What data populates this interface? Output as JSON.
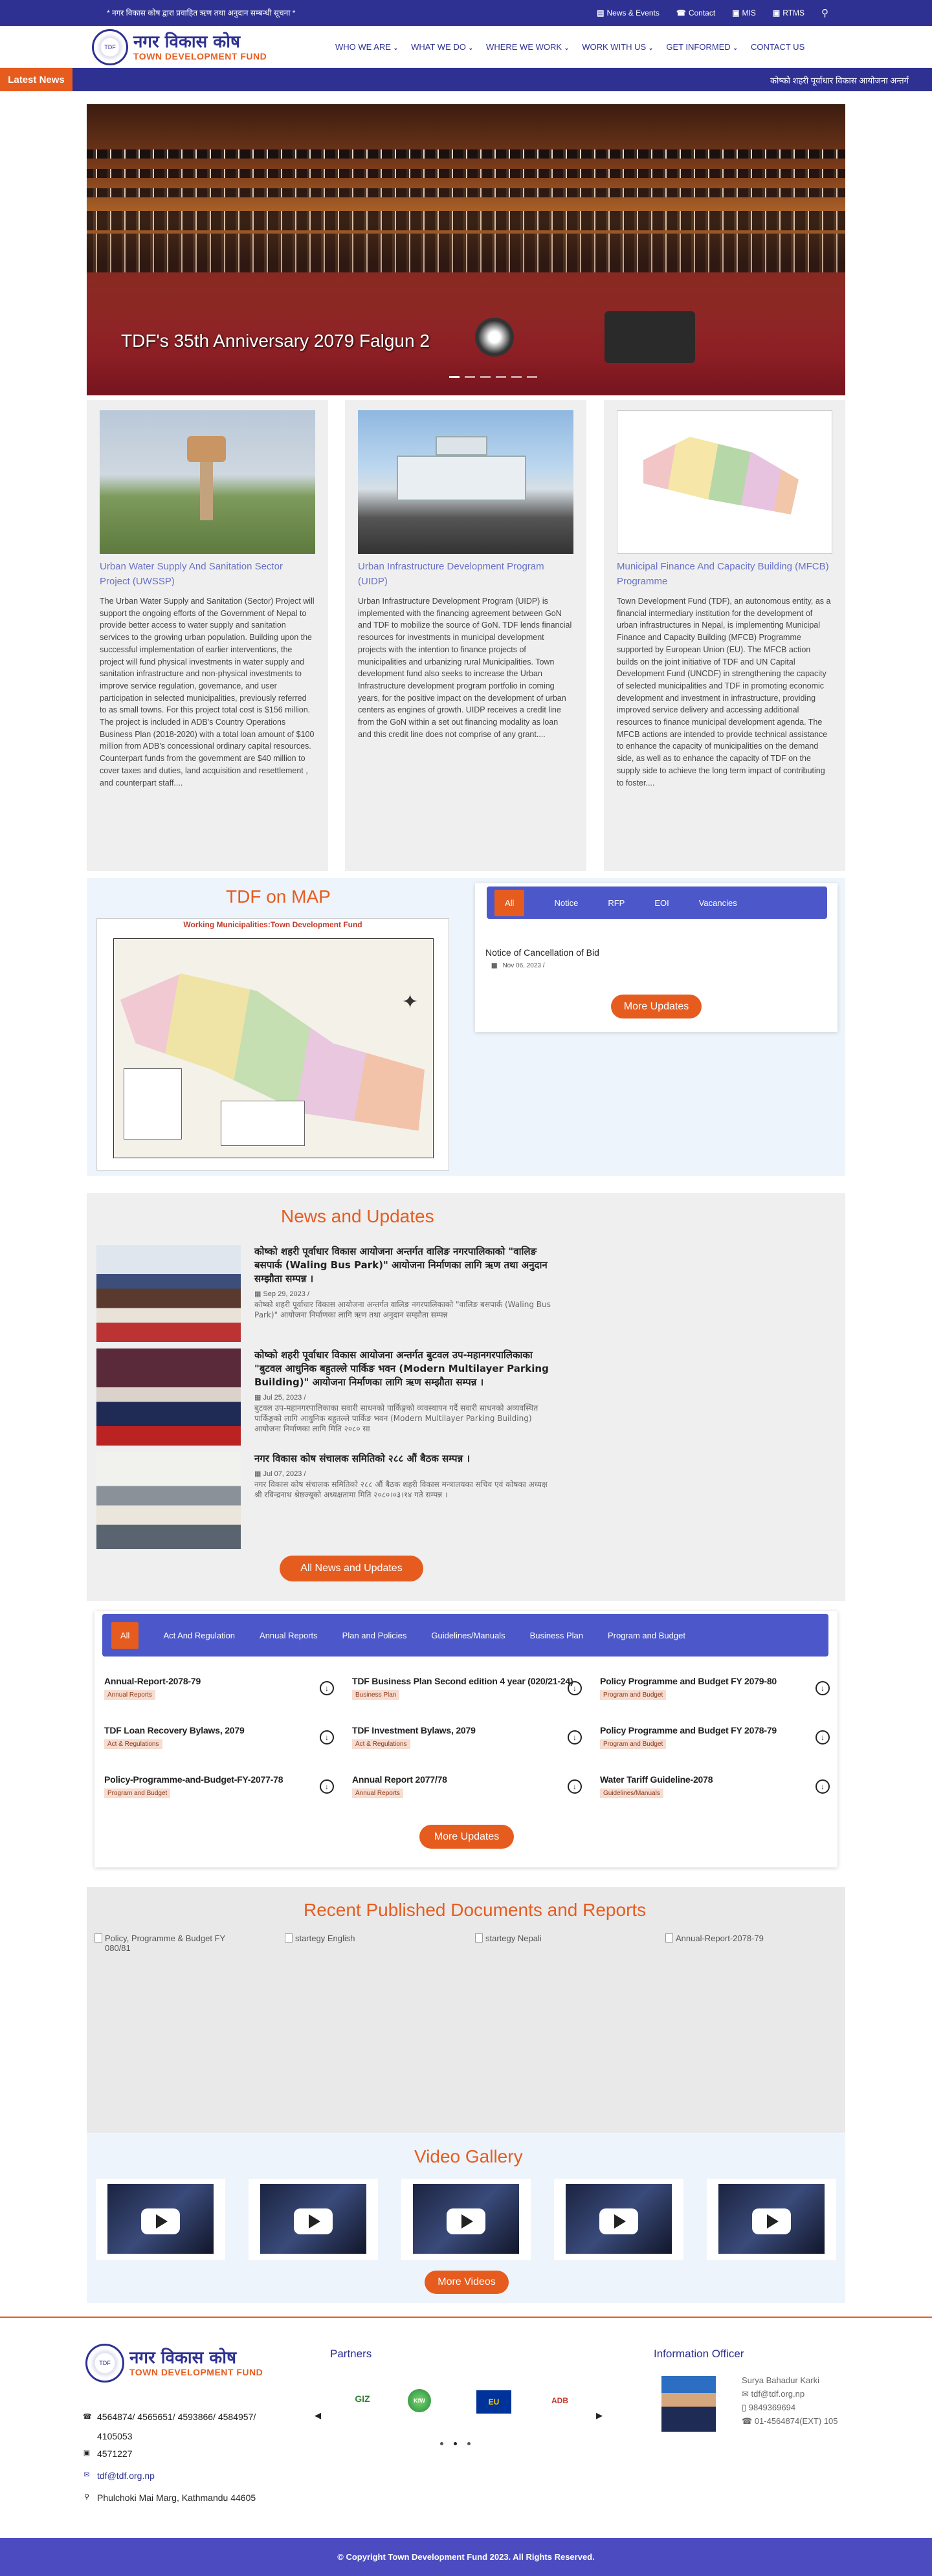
{
  "topbar": {
    "marquee": "* नगर विकास कोष द्वारा प्रवाहित ऋण तथा अनुदान सम्बन्धी सूचना *",
    "links": [
      {
        "icon": "news-icon",
        "label": "News & Events"
      },
      {
        "icon": "phone-icon",
        "label": "Contact"
      },
      {
        "icon": "mis-icon",
        "label": "MIS"
      },
      {
        "icon": "rtms-icon",
        "label": "RTMS"
      }
    ]
  },
  "brand": {
    "name_np": "नगर विकास कोष",
    "name_en": "TOWN DEVELOPMENT FUND"
  },
  "nav": {
    "items": [
      "WHO WE ARE",
      "WHAT WE DO",
      "WHERE WE WORK",
      "WORK WITH US",
      "GET INFORMED",
      "CONTACT US"
    ]
  },
  "latest": {
    "label": "Latest News",
    "text": "कोष्को शहरी पूर्वाधार विकास आयोजना अन्तर्ग"
  },
  "slider": {
    "caption": "TDF's 35th Anniversary 2079 Falgun 2"
  },
  "projects": [
    {
      "title": "Urban Water Supply And Sanitation Sector Project (UWSSP)",
      "text": "The Urban Water Supply and Sanitation (Sector) Project will support the ongoing efforts of the Government of Nepal to provide better access to water supply and sanitation services to the growing urban population. Building upon the successful implementation of earlier interventions, the project will fund physical investments in water supply and sanitation infrastructure and non-physical investments to improve service regulation, governance, and user participation in selected municipalities, previously referred to as small towns. For this project total cost is $156 million. The project is included in ADB's Country Operations Business Plan (2018-2020) with a total loan amount of $100 million from ADB's concessional ordinary capital resources. Counterpart funds from the government are $40 million to cover taxes and duties, land acquisition and resettlement , and counterpart staff...."
    },
    {
      "title": "Urban Infrastructure Development Program (UIDP)",
      "text": "Urban Infrastructure Development Program (UIDP) is implemented with the financing agreement between GoN and TDF to mobilize the source of GoN. TDF lends financial resources for investments in municipal development projects with the intention to finance projects of municipalities and urbanizing rural Municipalities. Town development fund also seeks to increase the Urban Infrastructure development program portfolio in coming years, for the positive impact on the development of urban centers as engines of growth. UIDP receives a credit line from the GoN within a set out financing modality as loan and this credit line does not comprise of any grant...."
    },
    {
      "title": "Municipal Finance And Capacity Building (MFCB) Programme",
      "text": "Town Development Fund (TDF), an autonomous entity, as a financial intermediary institution for the development of urban infrastructures in Nepal, is implementing Municipal Finance and Capacity Building (MFCB) Programme supported by European Union (EU). The MFCB action builds on the joint initiative of TDF and UN Capital Development Fund (UNCDF) in strengthening the capacity of selected municipalities and TDF in promoting economic development and investment in infrastructure, providing improved service delivery and accessing additional resources to finance municipal development agenda. The MFCB actions are intended to provide technical assistance to enhance the capacity of municipalities on the demand side, as well as to enhance the capacity of TDF on the supply side to achieve the long term impact of contributing to foster...."
    }
  ],
  "tdfmap": {
    "title": "TDF on MAP",
    "map_title": "Working Municipalities:Town Development Fund",
    "tabs": [
      "All",
      "Notice",
      "RFP",
      "EOI",
      "Vacancies"
    ],
    "notice_title": "Notice of Cancellation of Bid",
    "notice_date": "Nov 06, 2023 /",
    "more_label": "More Updates"
  },
  "news": {
    "title": "News and Updates",
    "items": [
      {
        "headline": "कोष्को शहरी पूर्वाधार विकास आयोजना अन्तर्गत वालिङ नगरपालिकाको \"वालिङ बसपार्क (Waling Bus Park)\" आयोजना निर्माणका लागि ऋण तथा अनुदान सम्झौता सम्पन्न ।",
        "date": "Sep 29, 2023 /",
        "excerpt": "कोष्को शहरी पूर्वाधार विकास आयोजना अन्तर्गत वालिङ नगरपालिकाको \"वालिङ बसपार्क (Waling Bus Park)\" आयोजना निर्माणका लागि ऋण तथा अनुदान सम्झौता सम्पन्न"
      },
      {
        "headline": "कोष्को शहरी पूर्वाधार विकास आयोजना अन्तर्गत बुटवल उप-महानगरपालिकाका \"बुटवल आधुनिक बहुतल्ले पार्किङ भवन (Modern Multilayer Parking Building)\" आयोजना निर्माणका लागि ऋण सम्झौता सम्पन्न ।",
        "date": "Jul 25, 2023 /",
        "excerpt": "बुटवल उप-महानगरपालिकाका सवारी साधनको पार्किङ्गको व्यवस्थापन गर्दै सवारी साधनको अव्यवस्थित पार्किङ्गको लागि आधुनिक बहुतल्ले पार्किङ भवन (Modern Multilayer Parking Building) आयोजना निर्माणका लागि मिति २०८० सा"
      },
      {
        "headline": "नगर विकास कोष संचालक समितिको २८८ औं बैठक सम्पन्न ।",
        "date": "Jul 07, 2023 /",
        "excerpt": "नगर विकास कोष संचालक समितिको २८८ औं बैठक शहरी विकास मन्त्रालयका सचिव एवं कोषका अध्यक्ष श्री रविन्द्रनाथ श्रेष्ठज्यूको अध्यक्षतामा मिति २०८०।०३।१४ गते सम्पन्न ।"
      }
    ],
    "all_label": "All News and Updates"
  },
  "docs": {
    "tabs": [
      "All",
      "Act And Regulation",
      "Annual Reports",
      "Plan and Policies",
      "Guidelines/Manuals",
      "Business Plan",
      "Program and Budget"
    ],
    "items": [
      {
        "title": "Annual-Report-2078-79",
        "tag": "Annual Reports"
      },
      {
        "title": "TDF Business Plan Second edition 4 year (020/21-24)",
        "tag": "Business Plan"
      },
      {
        "title": "Policy Programme and Budget FY 2079-80",
        "tag": "Program and Budget"
      },
      {
        "title": "TDF Loan Recovery Bylaws, 2079",
        "tag": "Act & Regulations"
      },
      {
        "title": "TDF Investment Bylaws, 2079",
        "tag": "Act & Regulations"
      },
      {
        "title": "Policy Programme and Budget FY 2078-79",
        "tag": "Program and Budget"
      },
      {
        "title": "Policy-Programme-and-Budget-FY-2077-78",
        "tag": "Program and Budget"
      },
      {
        "title": "Annual Report 2077/78",
        "tag": "Annual Reports"
      },
      {
        "title": "Water Tariff Guideline-2078",
        "tag": "Guidelines/Manuals"
      }
    ],
    "more_label": "More Updates"
  },
  "recent": {
    "title": "Recent Published Documents and Reports",
    "images": [
      "Policy, Programme & Budget FY 080/81",
      "startegy English",
      "startegy Nepali",
      "Annual-Report-2078-79"
    ]
  },
  "video": {
    "title": "Video Gallery",
    "more_label": "More Videos"
  },
  "footer": {
    "phone": "4564874/ 4565651/ 4593866/ 4584957/ 4105053",
    "fax": "4571227",
    "email": "tdf@tdf.org.np",
    "address": "Phulchoki Mai Marg, Kathmandu 44605",
    "partners_title": "Partners",
    "partners": [
      "GIZ",
      "EU",
      "ADB",
      "KfW"
    ],
    "info_title": "Information Officer",
    "officer_name": "Surya Bahadur Karki",
    "officer_email": "tdf@tdf.org.np",
    "officer_mobile": "9849369694",
    "officer_phone": "01-4564874(EXT) 105",
    "copyright": "© Copyright Town Development Fund 2023. All Rights Reserved."
  },
  "colors": {
    "primary": "#2e3192",
    "accent": "#e65c1f",
    "tab_bar": "#4c58c9"
  }
}
